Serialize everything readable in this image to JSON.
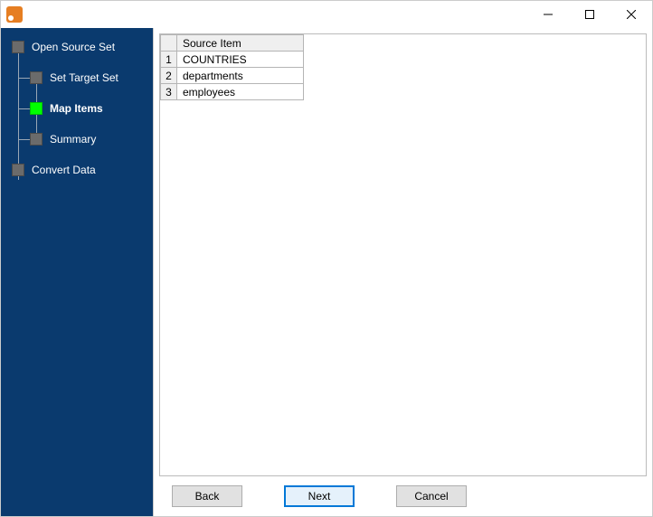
{
  "window": {
    "title": ""
  },
  "sidebar": {
    "items": [
      {
        "label": "Open Source Set",
        "level": 0,
        "active": false
      },
      {
        "label": "Set Target Set",
        "level": 1,
        "active": false
      },
      {
        "label": "Map Items",
        "level": 1,
        "active": true
      },
      {
        "label": "Summary",
        "level": 1,
        "active": false
      },
      {
        "label": "Convert Data",
        "level": 0,
        "active": false
      }
    ]
  },
  "grid": {
    "header": "Source Item",
    "rows": [
      {
        "num": "1",
        "value": "COUNTRIES"
      },
      {
        "num": "2",
        "value": "departments"
      },
      {
        "num": "3",
        "value": "employees"
      }
    ]
  },
  "buttons": {
    "back": "Back",
    "next": "Next",
    "cancel": "Cancel"
  }
}
